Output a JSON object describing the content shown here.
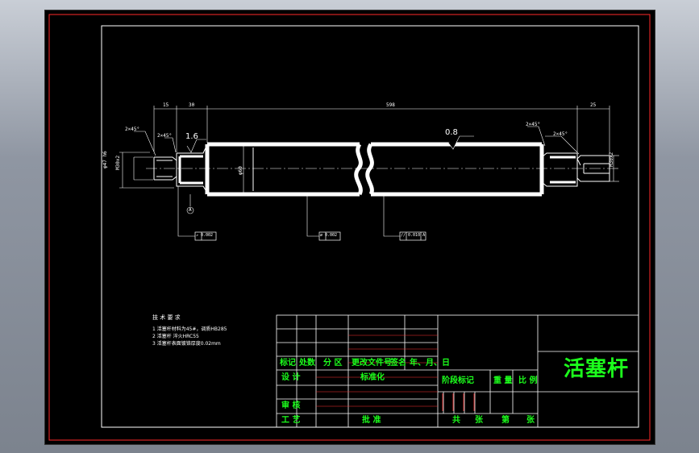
{
  "drawing": {
    "dimensions": {
      "left_15": "15",
      "left_30": "30",
      "overall": "598",
      "right_small": "25",
      "diameter_left_a": "φ47 h6",
      "diameter_left_b": "M30x2",
      "diameter_body": "φ60",
      "diameter_right": "M30x2",
      "chamfer_left_outer": "2×45°",
      "chamfer_left_inner": "2×45°",
      "chamfer_right_inner": "2×45°",
      "chamfer_right_outer": "2×45°"
    },
    "roughness": {
      "left": "1.6",
      "main": "0.8"
    },
    "tolerances": {
      "tol_1": "↗ 0.002",
      "tol_2": "⌀ 0.002",
      "tol_3": "// 0.010 A"
    },
    "datum": "A",
    "tech_requirements": {
      "heading": "技 术 要 求",
      "items": [
        "1 活塞杆材料为45#，调质HB285",
        "2 活塞杆 淬火HRC55",
        "3 活塞杆表面镀铬厚度0.02mm"
      ]
    }
  },
  "title_block": {
    "part_name": "活塞杆",
    "rev_header": [
      "标记",
      "处数",
      "分 区",
      "更改文件号",
      "签名",
      "年、月、日"
    ],
    "design": "设 计",
    "standardize": "标准化",
    "review": "审 核",
    "process": "工 艺",
    "approve": "批 准",
    "stage_mark": "阶段标记",
    "weight": "重 量",
    "scale": "比 例",
    "total": "共",
    "sheets": "张",
    "sheet_no": "第",
    "sheet_suffix": "张"
  }
}
